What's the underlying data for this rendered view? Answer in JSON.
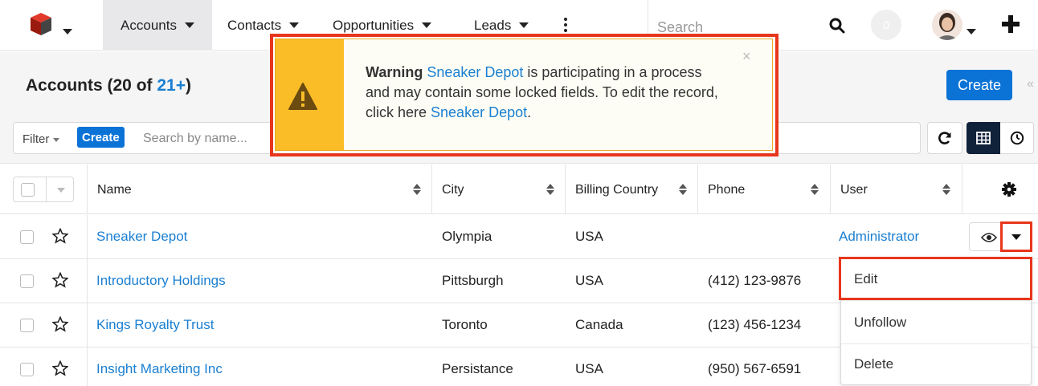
{
  "nav": {
    "tabs": [
      "Accounts",
      "Contacts",
      "Opportunities",
      "Leads"
    ],
    "search_placeholder": "Search",
    "notification_count": "0"
  },
  "header": {
    "title_prefix": "Accounts (20 of ",
    "title_count": "21+",
    "title_suffix": ")",
    "create_label": "Create",
    "collapse_glyph": "«"
  },
  "filter": {
    "filter_label": "Filter",
    "create_label": "Create",
    "search_placeholder": "Search by name..."
  },
  "table": {
    "columns": [
      "Name",
      "City",
      "Billing Country",
      "Phone",
      "User"
    ],
    "rows": [
      {
        "name": "Sneaker Depot",
        "city": "Olympia",
        "country": "USA",
        "phone": "",
        "user": "Administrator"
      },
      {
        "name": "Introductory Holdings",
        "city": "Pittsburgh",
        "country": "USA",
        "phone": "(412) 123-9876",
        "user": ""
      },
      {
        "name": "Kings Royalty Trust",
        "city": "Toronto",
        "country": "Canada",
        "phone": "(123) 456-1234",
        "user": ""
      },
      {
        "name": "Insight Marketing Inc",
        "city": "Persistance",
        "country": "USA",
        "phone": "(950) 567-6591",
        "user": ""
      }
    ]
  },
  "row_menu": {
    "items": [
      "Edit",
      "Unfollow",
      "Delete"
    ]
  },
  "warning": {
    "bold_label": "Warning",
    "record_link": "Sneaker Depot",
    "text_1": " is participating in a process and may contain some locked fields. To edit the record, click here ",
    "record_link_2": "Sneaker Depot",
    "text_end": ".",
    "close_glyph": "×"
  },
  "colors": {
    "accent": "#0b72d6",
    "link": "#1a7fd1",
    "highlight": "#e8361c",
    "warning": "#fbbd27"
  }
}
